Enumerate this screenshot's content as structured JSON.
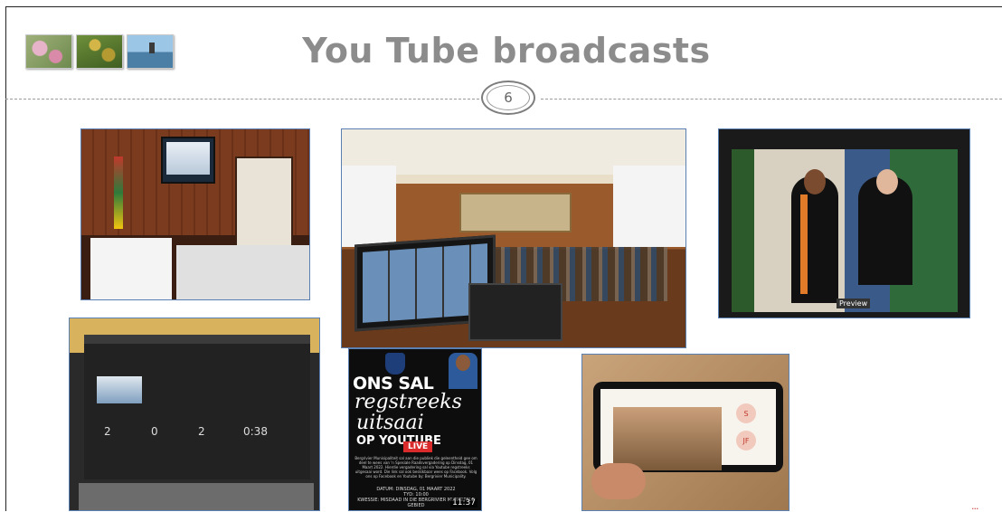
{
  "slide": {
    "title": "You Tube broadcasts",
    "page_number": "6",
    "header_thumbnails": [
      {
        "icon": "flowers-thumbnail"
      },
      {
        "icon": "fynbos-thumbnail"
      },
      {
        "icon": "harbour-tower-thumbnail"
      }
    ]
  },
  "photos": {
    "p1": {
      "icon": "presentation-room-photo"
    },
    "p2": {
      "icon": "council-chamber-broadcast-photo"
    },
    "p3": {
      "icon": "oath-ceremony-screen-photo",
      "overlay_label": "Preview"
    },
    "p4": {
      "icon": "youtube-studio-laptop-photo",
      "stats": [
        {
          "value": "2"
        },
        {
          "value": "0"
        },
        {
          "value": "2"
        },
        {
          "value": "0:38"
        }
      ]
    },
    "p5": {
      "line1": "ONS SAL",
      "line2": "regstreeks",
      "line3": "uitsaai",
      "line4": "OP YOUTUBE",
      "live": "LIVE",
      "body": "Bergrivier Munisipaliteit sal aan die publiek die geleentheid gee om deel te wees van 'n Spesiale Raadsvergadering op Dinsdag, 01 Maart 2022. Hierdie vergadering sal via Youtube regstreeks uitgesaai word. Die link sal ook beskikbaar wees op Facebook. Volg ons op Facebook en Youtube by: Bergrivier Municipality.",
      "date": "DATUM: DINSDAG, 01 MAART 2022",
      "time_line": "TYD: 10:00",
      "subject": "KWESSIE: MISDAAD IN DIE BERGRIVIER MUNISIPALE GEBIED",
      "duration": "11:37"
    },
    "p6": {
      "icon": "phone-video-meeting-photo",
      "avatars": [
        "S",
        "JF"
      ]
    }
  },
  "footer": {
    "more": "..."
  }
}
